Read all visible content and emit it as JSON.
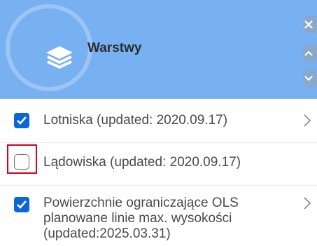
{
  "panel": {
    "title": "Warstwy",
    "header_color": "#77b1f2"
  },
  "controls": {
    "close_icon": "close-icon",
    "up_icon": "chevron-up-icon",
    "down_icon": "chevron-down-icon"
  },
  "layers": [
    {
      "label": "Lotniska (updated: 2020.09.17)",
      "checked": true,
      "has_chevron": true
    },
    {
      "label": "Lądowiska (updated: 2020.09.17)",
      "checked": false,
      "has_chevron": false
    },
    {
      "label_lines": [
        "Powierzchnie ograniczające OLS",
        "planowane linie max. wysokości",
        "(updated:2025.03.31)"
      ],
      "checked": true,
      "has_chevron": true
    }
  ],
  "colors": {
    "checkbox_checked": "#0b66d6",
    "focus_outline": "#d0021b"
  }
}
